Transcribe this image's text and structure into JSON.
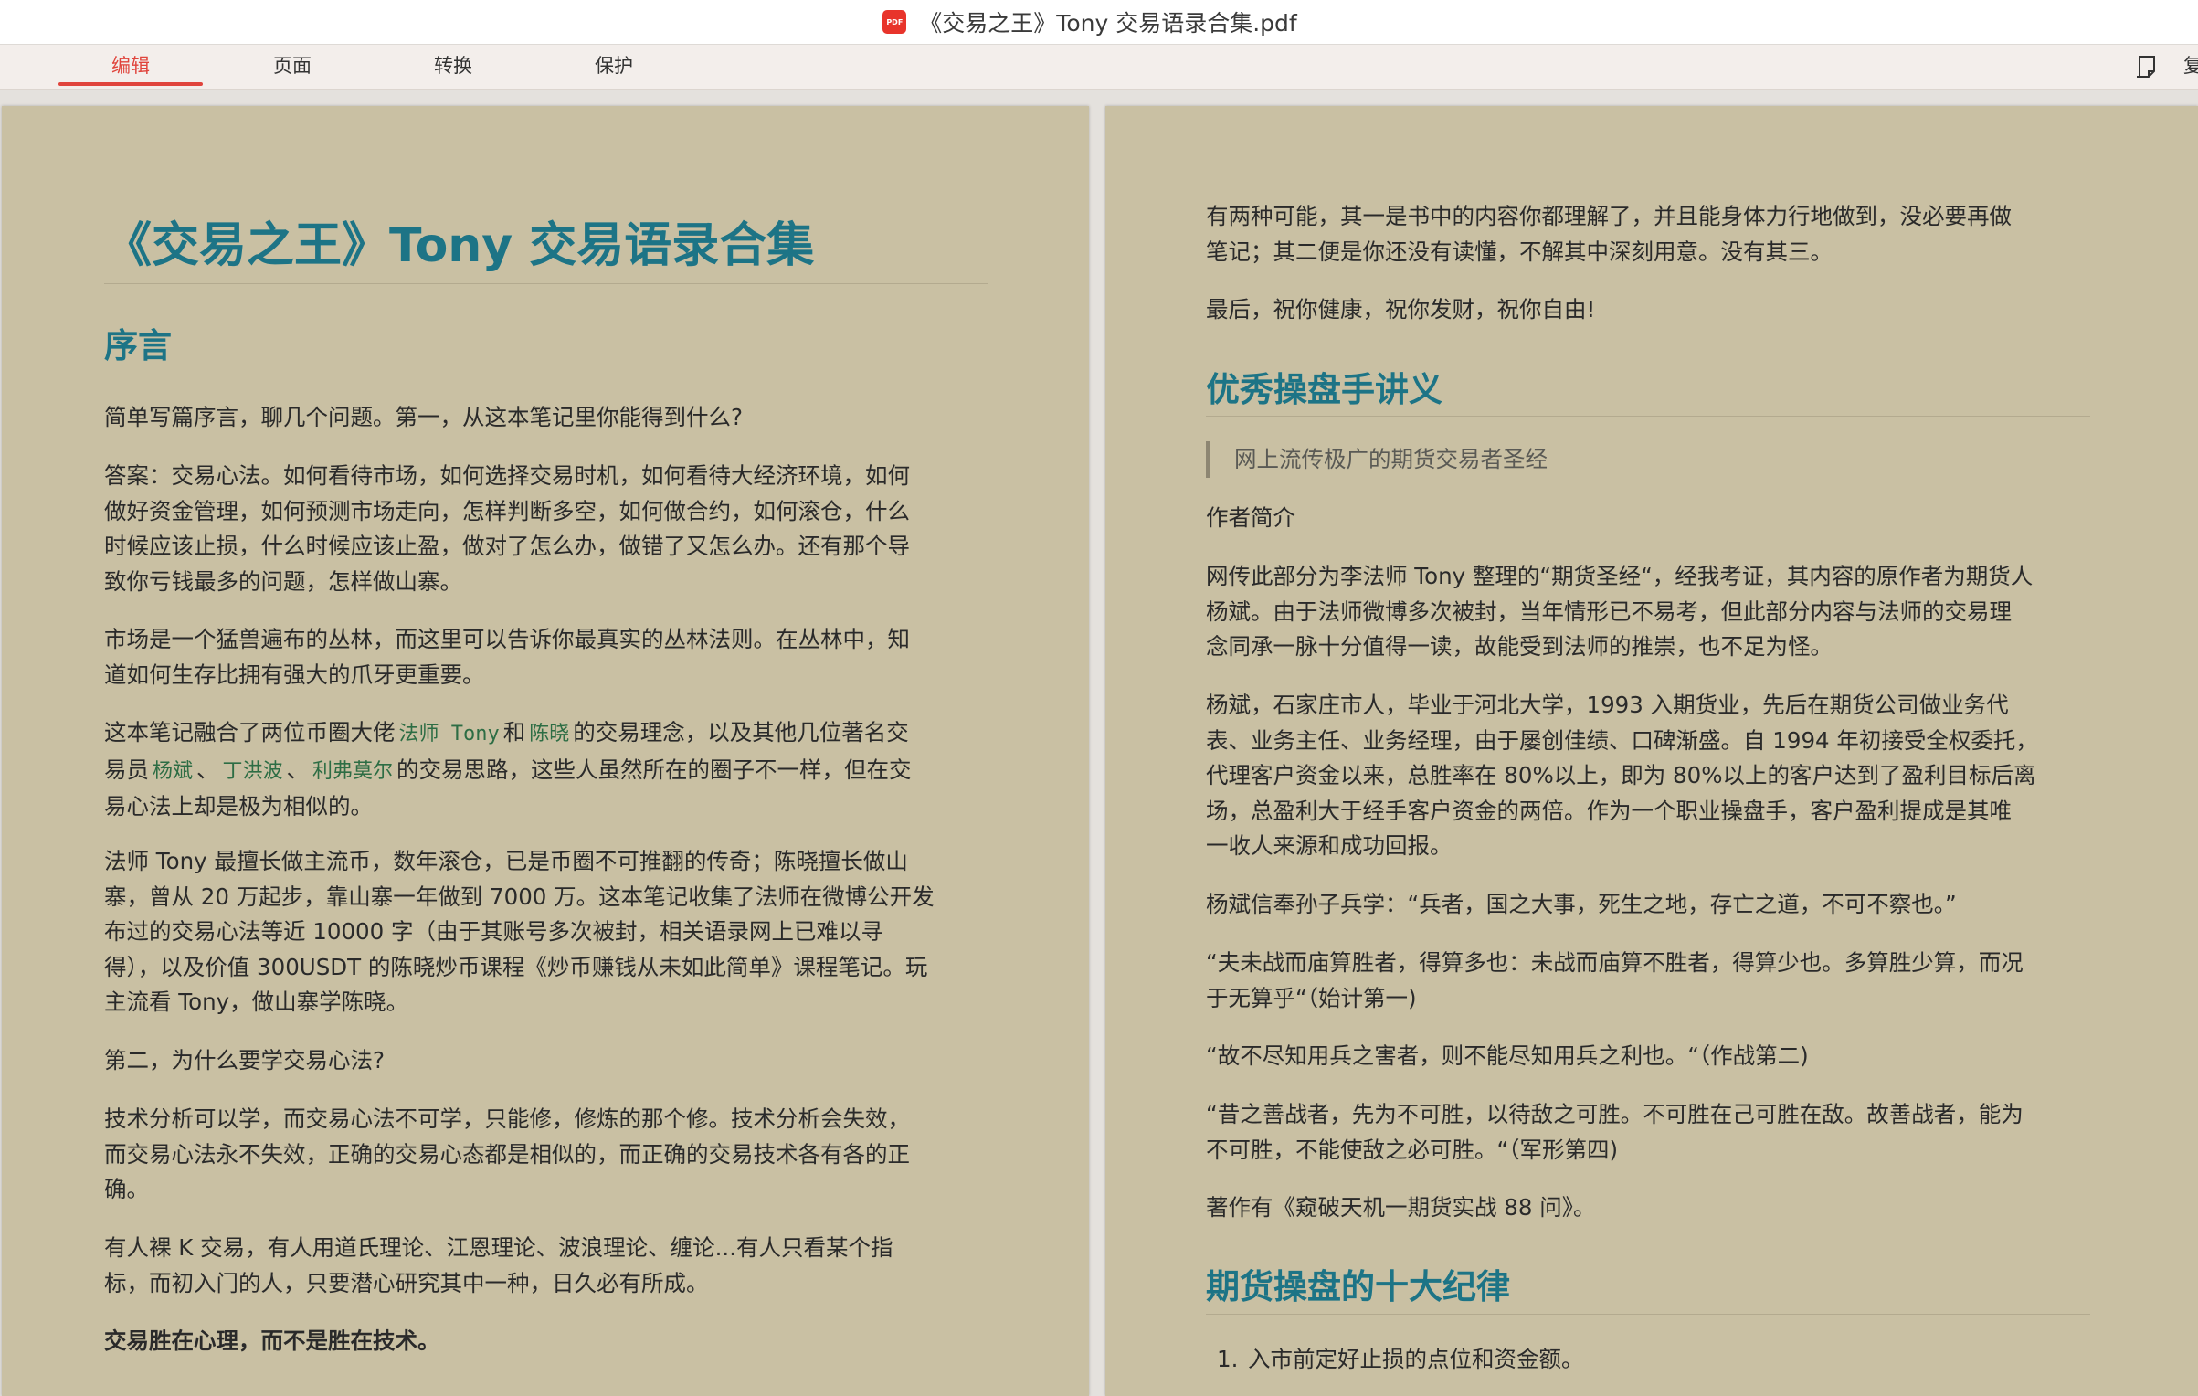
{
  "window": {
    "title": "《交易之王》Tony 交易语录合集.pdf",
    "app_icon": "pdf-icon",
    "app_icon_label": "PDF"
  },
  "toolbar": {
    "tabs": [
      {
        "label": "编辑",
        "active": true
      },
      {
        "label": "页面",
        "active": false
      },
      {
        "label": "转换",
        "active": false
      },
      {
        "label": "保护",
        "active": false
      }
    ],
    "right_icon": "note-edit-icon",
    "right_label": "复"
  },
  "left_page": {
    "title": "《交易之王》Tony 交易语录合集",
    "section1": "序言",
    "p1": "简单写篇序言，聊几个问题。第一，从这本笔记里你能得到什么?",
    "p2_lines": [
      "答案：交易心法。如何看待市场，如何选择交易时机，如何看待大经济环境，如何",
      "做好资金管理，如何预测市场走向，怎样判断多空，如何做合约，如何滚仓，什么",
      "时候应该止损，什么时候应该止盈，做对了怎么办，做错了又怎么办。还有那个导",
      "致你亏钱最多的问题，怎样做山寨。"
    ],
    "p3_lines": [
      "市场是一个猛兽遍布的丛林，而这里可以告诉你最真实的丛林法则。在丛林中，知",
      "道如何生存比拥有强大的爪牙更重要。"
    ],
    "p4": {
      "a": "这本笔记融合了两位币圈大佬",
      "code1": "法师 Tony",
      "b": "和",
      "code2": "陈晓",
      "c": "的交易理念，以及其他几位著名交",
      "d": "易员",
      "code3": "杨斌",
      "sep1": "、",
      "code4": "丁洪波",
      "sep2": "、",
      "code5": "利弗莫尔",
      "e": "的交易思路，这些人虽然所在的圈子不一样，但在交",
      "f": "易心法上却是极为相似的。"
    },
    "p5_lines": [
      "法师 Tony 最擅长做主流币，数年滚仓，已是币圈不可推翻的传奇；陈晓擅长做山",
      "寨，曾从 20 万起步，靠山寨一年做到 7000 万。这本笔记收集了法师在微博公开发",
      "布过的交易心法等近 10000 字（由于其账号多次被封，相关语录网上已难以寻",
      "得），以及价值 300USDT 的陈晓炒币课程《炒币赚钱从未如此简单》课程笔记。玩",
      "主流看 Tony，做山寨学陈晓。"
    ],
    "p6": "第二，为什么要学交易心法?",
    "p7_lines": [
      "技术分析可以学，而交易心法不可学，只能修，修炼的那个修。技术分析会失效，",
      "而交易心法永不失效，正确的交易心态都是相似的，而正确的交易技术各有各的正",
      "确。"
    ],
    "p8_lines": [
      "有人裸 K 交易，有人用道氏理论、江恩理论、波浪理论、缠论...有人只看某个指",
      "标，而初入门的人，只要潜心研究其中一种，日久必有所成。"
    ],
    "p9": "交易胜在心理，而不是胜在技术。"
  },
  "right_page": {
    "p1_lines": [
      "有两种可能，其一是书中的内容你都理解了，并且能身体力行地做到，没必要再做",
      "笔记；其二便是你还没有读懂，不解其中深刻用意。没有其三。"
    ],
    "p2": "最后，祝你健康，祝你发财，祝你自由!",
    "section2": "优秀操盘手讲义",
    "quote": "网上流传极广的期货交易者圣经",
    "p3": "作者简介",
    "p4_lines": [
      "网传此部分为李法师 Tony 整理的“期货圣经“，经我考证，其内容的原作者为期货人",
      "杨斌。由于法师微博多次被封，当年情形已不易考，但此部分内容与法师的交易理",
      "念同承一脉十分值得一读，故能受到法师的推崇，也不足为怪。"
    ],
    "p5_lines": [
      "杨斌，石家庄市人，毕业于河北大学，1993 入期货业，先后在期货公司做业务代",
      "表、业务主任、业务经理，由于屡创佳绩、口碑渐盛。自 1994 年初接受全权委托，",
      "代理客户资金以来，总胜率在 80%以上，即为 80%以上的客户达到了盈利目标后离",
      "场，总盈利大于经手客户资金的两倍。作为一个职业操盘手，客户盈利提成是其唯",
      "一收人来源和成功回报。"
    ],
    "p6": "杨斌信奉孙子兵学：“兵者，国之大事，死生之地，存亡之道，不可不察也。”",
    "p7_lines": [
      "“夫未战而庙算胜者，得算多也：未战而庙算不胜者，得算少也。多算胜少算，而况",
      "于无算乎“（始计第一)"
    ],
    "p8": "“故不尽知用兵之害者，则不能尽知用兵之利也。“（作战第二)",
    "p9_lines": [
      "“昔之善战者，先为不可胜，以待敌之可胜。不可胜在己可胜在敌。故善战者，能为",
      "不可胜，不能使敌之必可胜。“（军形第四)"
    ],
    "p10": "著作有《窥破天机一期货实战 88 问》。",
    "section3": "期货操盘的十大纪律",
    "list_item1_num": "1.",
    "list_item1": "入市前定好止损的点位和资金额。"
  }
}
